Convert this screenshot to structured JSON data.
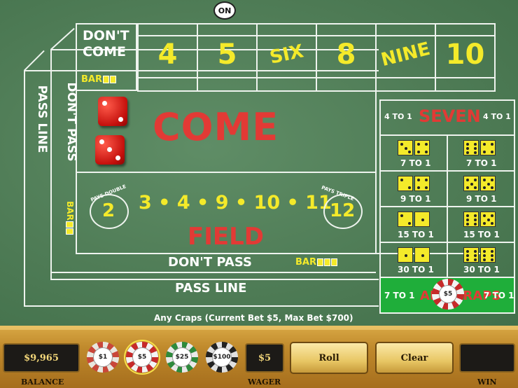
{
  "puck": {
    "label": "ON"
  },
  "dont_come": {
    "line1": "DON'T",
    "line2": "COME",
    "bar": "BAR"
  },
  "point_numbers": [
    "4",
    "5",
    "SIX",
    "8",
    "NINE",
    "10"
  ],
  "come": {
    "label": "COME"
  },
  "dont_pass_vertical": {
    "label": "DON'T PASS",
    "bar": "BAR"
  },
  "pass_line_vertical": {
    "label": "PASS LINE"
  },
  "field": {
    "label": "FIELD",
    "pays_double": "PAYS DOUBLE",
    "pays_triple": "PAYS TRIPLE",
    "two": "2",
    "twelve": "12",
    "numbers": "3 • 4 • 9 • 10 • 11"
  },
  "dont_pass_bar": {
    "label": "DON'T PASS",
    "bar": "BAR"
  },
  "pass_line": {
    "label": "PASS LINE"
  },
  "proposition": {
    "seven": {
      "label": "SEVEN",
      "left": "4 TO 1",
      "right": "4 TO 1"
    },
    "hardways": [
      {
        "payout": "7 TO 1"
      },
      {
        "payout": "7 TO 1"
      },
      {
        "payout": "9 TO 1"
      },
      {
        "payout": "9 TO 1"
      },
      {
        "payout": "15 TO 1"
      },
      {
        "payout": "15 TO 1"
      },
      {
        "payout": "30 TO 1"
      },
      {
        "payout": "30 TO 1"
      }
    ],
    "any_craps": {
      "label": "ANY CRAPS",
      "left": "7 TO 1",
      "right": "7 TO 1",
      "chip": "$5"
    }
  },
  "status_text": "Any Craps (Current Bet $5,  Max Bet $700)",
  "bottom": {
    "balance_value": "$9,965",
    "balance_label": "BALANCE",
    "chips": [
      "$1",
      "$5",
      "$25",
      "$100"
    ],
    "selected_chip": "$5",
    "wager_value": "$5",
    "wager_label": "WAGER",
    "roll_label": "Roll",
    "clear_label": "Clear",
    "win_value": "",
    "win_label": "WIN"
  },
  "colors": {
    "felt": "#4f7c56",
    "yellow": "#f4ea2a",
    "red": "#e23a35",
    "gold": "#c08a2c"
  }
}
